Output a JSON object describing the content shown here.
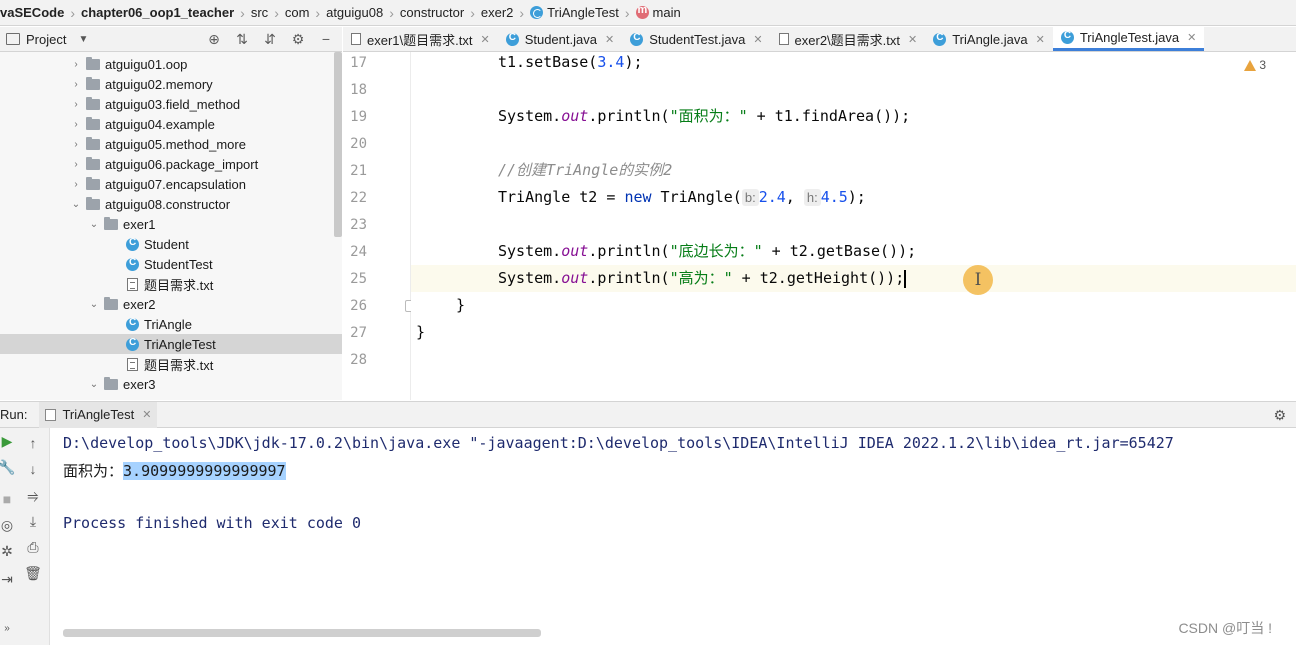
{
  "breadcrumb": {
    "items": [
      "vaSECode",
      "chapter06_oop1_teacher",
      "src",
      "com",
      "atguigu08",
      "constructor",
      "exer2",
      "TriAngleTest",
      "main"
    ]
  },
  "project_panel": {
    "label": "Project",
    "tree": [
      {
        "label": "atguigu01.oop",
        "type": "package",
        "expanded": false
      },
      {
        "label": "atguigu02.memory",
        "type": "package",
        "expanded": false
      },
      {
        "label": "atguigu03.field_method",
        "type": "package",
        "expanded": false
      },
      {
        "label": "atguigu04.example",
        "type": "package",
        "expanded": false
      },
      {
        "label": "atguigu05.method_more",
        "type": "package",
        "expanded": false
      },
      {
        "label": "atguigu06.package_import",
        "type": "package",
        "expanded": false
      },
      {
        "label": "atguigu07.encapsulation",
        "type": "package",
        "expanded": false
      },
      {
        "label": "atguigu08.constructor",
        "type": "package",
        "expanded": true
      },
      {
        "label": "exer1",
        "type": "package",
        "expanded": true
      },
      {
        "label": "Student",
        "type": "class"
      },
      {
        "label": "StudentTest",
        "type": "class"
      },
      {
        "label": "题目需求.txt",
        "type": "txt"
      },
      {
        "label": "exer2",
        "type": "package",
        "expanded": true
      },
      {
        "label": "TriAngle",
        "type": "class"
      },
      {
        "label": "TriAngleTest",
        "type": "class",
        "selected": true
      },
      {
        "label": "题目需求.txt",
        "type": "txt"
      },
      {
        "label": "exer3",
        "type": "package",
        "expanded": true
      }
    ]
  },
  "editor": {
    "tabs": [
      {
        "label": "exer1\\题目需求.txt",
        "icon": "txt"
      },
      {
        "label": "Student.java",
        "icon": "class"
      },
      {
        "label": "StudentTest.java",
        "icon": "class"
      },
      {
        "label": "exer2\\题目需求.txt",
        "icon": "txt"
      },
      {
        "label": "TriAngle.java",
        "icon": "class"
      },
      {
        "label": "TriAngleTest.java",
        "icon": "class",
        "active": true
      }
    ],
    "line_numbers": [
      "17",
      "18",
      "19",
      "20",
      "21",
      "22",
      "23",
      "24",
      "25",
      "26",
      "27",
      "28"
    ],
    "code": {
      "l17": {
        "a": "t1.setBase(",
        "b": "3.4",
        "c": ");"
      },
      "l19": {
        "a": "System.",
        "b": "out",
        "c": ".println(",
        "d": "\"面积为：\"",
        "e": " + t1.findArea());"
      },
      "l21": {
        "a": "//创建TriAngle的实例2"
      },
      "l22": {
        "a": "TriAngle t2 = ",
        "b": "new",
        "c": " TriAngle(",
        "hint_b": "b:",
        "d": "2.4",
        "e": ", ",
        "hint_h": "h:",
        "f": "4.5",
        "g": ");"
      },
      "l24": {
        "a": "System.",
        "b": "out",
        "c": ".println(",
        "d": "\"底边长为：\"",
        "e": " + t2.getBase());"
      },
      "l25": {
        "a": "System.",
        "b": "out",
        "c": ".println(",
        "d": "\"高为：\"",
        "e": " + t2.getHeight());"
      },
      "l26": {
        "a": "}"
      },
      "l27": {
        "a": "}"
      }
    },
    "warnings_count": "3"
  },
  "run": {
    "label": "Run:",
    "tab": "TriAngleTest",
    "console": {
      "cmd": "D:\\develop_tools\\JDK\\jdk-17.0.2\\bin\\java.exe \"-javaagent:D:\\develop_tools\\IDEA\\IntelliJ IDEA 2022.1.2\\lib\\idea_rt.jar=65427",
      "area_label": "面积为：",
      "area_value": "3.9099999999999997",
      "exit": "Process finished with exit code 0"
    }
  },
  "watermark": "CSDN @叮当 !"
}
